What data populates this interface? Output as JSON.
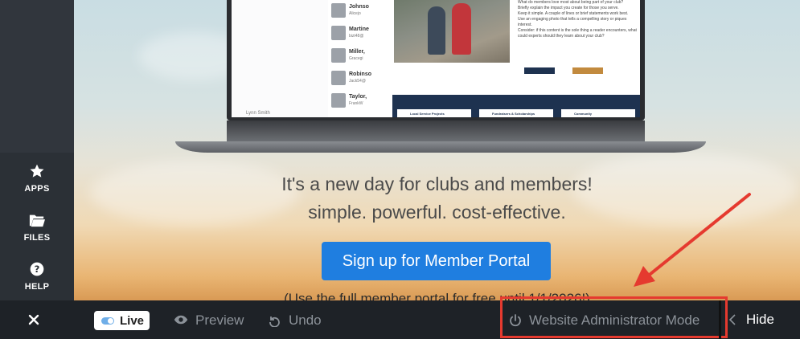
{
  "sidebar": {
    "items": [
      {
        "icon": "star-icon",
        "label": "APPS"
      },
      {
        "icon": "folder-icon",
        "label": "FILES"
      },
      {
        "icon": "help-icon",
        "label": "HELP"
      }
    ]
  },
  "screen": {
    "chat": [
      {
        "name": "Johnso",
        "sub": "Alicejo"
      },
      {
        "name": "Martine",
        "sub": "bizt48@"
      },
      {
        "name": "Miller,",
        "sub": "Gracegi"
      },
      {
        "name": "Robinso",
        "sub": "Jack54@"
      },
      {
        "name": "Taylor,",
        "sub": "FrankW"
      }
    ],
    "chat_footer": "Lynn Smith",
    "bullets": [
      "What do members love most about being part of your club?",
      "Briefly explain the impact you create for those you serve.",
      "Keep it simple. A couple of lines or brief statements work best.",
      "Use an engaging photo that tells a compelling story or piques interest.",
      "Consider: if this content is the sole thing a reader encounters, what could experts should they learn about your club?"
    ],
    "cards": [
      "Local Service Projects",
      "Fundraisers & Scholarships",
      "Community"
    ]
  },
  "hero": {
    "tagline_line1": "It's a new day for clubs and members!",
    "tagline_line2": "simple. powerful. cost-effective.",
    "cta_label": "Sign up for Member Portal",
    "note": "(Use the full member portal for free until 1/1/2026!)"
  },
  "bottombar": {
    "close_icon": "close-icon",
    "live_label": "Live",
    "preview_label": "Preview",
    "undo_label": "Undo",
    "admin_mode_label": "Website Administrator Mode",
    "hide_label": "Hide"
  },
  "colors": {
    "cta": "#1f7ee0",
    "highlight": "#e53a2f",
    "bar": "#1e2227"
  }
}
